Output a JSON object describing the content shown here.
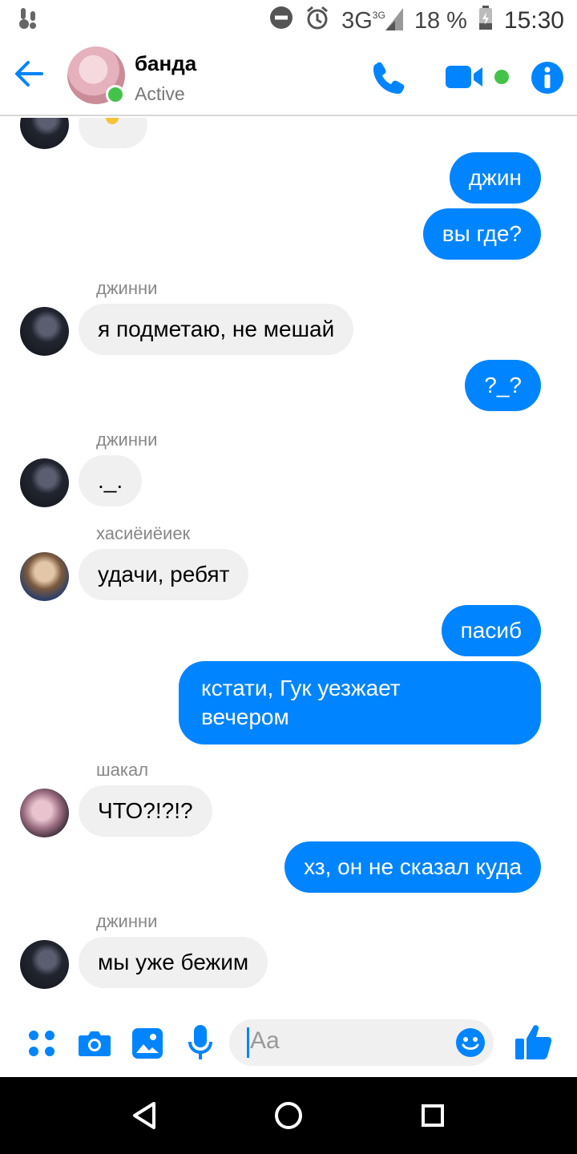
{
  "status_bar": {
    "network": "3G",
    "network_sup": "3G",
    "battery": "18 %",
    "time": "15:30"
  },
  "header": {
    "title": "банда",
    "status": "Active"
  },
  "messages": [
    {
      "text": "джин"
    },
    {
      "text": "вы где?"
    },
    {
      "sender": "джинни",
      "text": "я подметаю, не мешай"
    },
    {
      "text": "?_?"
    },
    {
      "sender": "джинни",
      "text": "._."
    },
    {
      "sender": "хасиёиёиек",
      "text": "удачи, ребят"
    },
    {
      "text": "пасиб"
    },
    {
      "text_line1": "кстати, Гук уезжает",
      "text_line2": "вечером"
    },
    {
      "sender": "шакал",
      "text": "ЧТО?!?!?"
    },
    {
      "text": "хз, он не сказал куда"
    },
    {
      "sender": "джинни",
      "text": "мы уже бежим"
    }
  ],
  "composer": {
    "placeholder": "Aa"
  },
  "colors": {
    "accent": "#0084ff",
    "incoming_bubble": "#f1f0f0",
    "active_green": "#44c24a"
  },
  "icons": [
    "back-arrow-icon",
    "phone-icon",
    "video-icon",
    "info-icon",
    "apps-icon",
    "camera-icon",
    "gallery-icon",
    "microphone-icon",
    "emoji-icon",
    "thumbs-up-icon",
    "nav-back-icon",
    "nav-home-icon",
    "nav-recents-icon"
  ]
}
